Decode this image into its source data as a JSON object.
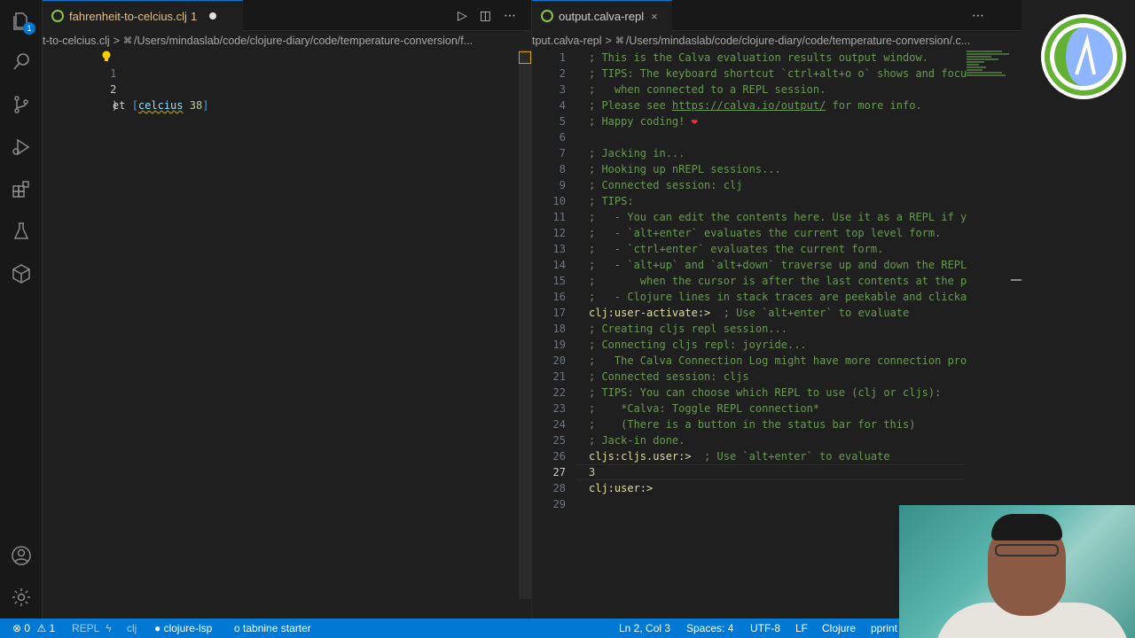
{
  "activity": {
    "badge_count": "1"
  },
  "left_editor": {
    "tab_label": "fahrenheit-to-celcius.clj",
    "tab_problems": "1",
    "breadcrumb_file": "t-to-celcius.clj",
    "breadcrumb_sep": ">",
    "breadcrumb_path": "/Users/mindaslab/code/clojure-diary/code/temperature-conversion/f...",
    "lines": [
      {
        "num": "1",
        "prefix": "et ",
        "bracket_open": "[",
        "sym": "celcius",
        "num_val": "38",
        "bracket_close": "]"
      },
      {
        "num": "2",
        "text": ")"
      }
    ]
  },
  "right_editor": {
    "tab_label": "output.calva-repl",
    "tab_close": "×",
    "breadcrumb_file": "tput.calva-repl",
    "breadcrumb_sep": ">",
    "breadcrumb_path": "/Users/mindaslab/code/clojure-diary/code/temperature-conversion/.c...",
    "line_4": {
      "before": "; Please see ",
      "link": "https://calva.io/output/",
      "after": " for more info."
    },
    "line_5": {
      "text": "; Happy coding! ",
      "heart": "❤"
    },
    "line_17": {
      "prompt": "clj:user-activate:>",
      "comment": "  ; Use `alt+enter` to evaluate"
    },
    "line_26": {
      "prompt": "cljs:cljs.user:>",
      "comment": "  ; Use `alt+enter` to evaluate"
    },
    "line_28": {
      "prompt": "clj:user:>"
    },
    "lines": [
      {
        "num": "1",
        "text": "; This is the Calva evaluation results output window."
      },
      {
        "num": "2",
        "text": "; TIPS: The keyboard shortcut `ctrl+alt+o o` shows and focus"
      },
      {
        "num": "3",
        "text": ";   when connected to a REPL session."
      },
      {
        "num": "6",
        "text": ""
      },
      {
        "num": "7",
        "text": "; Jacking in..."
      },
      {
        "num": "8",
        "text": "; Hooking up nREPL sessions..."
      },
      {
        "num": "9",
        "text": "; Connected session: clj"
      },
      {
        "num": "10",
        "text": "; TIPS:"
      },
      {
        "num": "11",
        "text": ";   - You can edit the contents here. Use it as a REPL if yo"
      },
      {
        "num": "12",
        "text": ";   - `alt+enter` evaluates the current top level form."
      },
      {
        "num": "13",
        "text": ";   - `ctrl+enter` evaluates the current form."
      },
      {
        "num": "14",
        "text": ";   - `alt+up` and `alt+down` traverse up and down the REPL"
      },
      {
        "num": "15",
        "text": ";       when the cursor is after the last contents at the pro"
      },
      {
        "num": "16",
        "text": ";   - Clojure lines in stack traces are peekable and clickab"
      },
      {
        "num": "18",
        "text": "; Creating cljs repl session..."
      },
      {
        "num": "19",
        "text": "; Connecting cljs repl: joyride..."
      },
      {
        "num": "20",
        "text": ";   The Calva Connection Log might have more connection prog"
      },
      {
        "num": "21",
        "text": "; Connected session: cljs"
      },
      {
        "num": "22",
        "text": "; TIPS: You can choose which REPL to use (clj or cljs):"
      },
      {
        "num": "23",
        "text": ";    *Calva: Toggle REPL connection*"
      },
      {
        "num": "24",
        "text": ";    (There is a button in the status bar for this)"
      },
      {
        "num": "25",
        "text": "; Jack-in done."
      },
      {
        "num": "27",
        "text": "3"
      },
      {
        "num": "29",
        "text": ""
      }
    ],
    "line_nums": {
      "n4": "4",
      "n5": "5",
      "n17": "17",
      "n26": "26",
      "n28": "28"
    }
  },
  "statusbar": {
    "errors": "0",
    "warnings": "1",
    "repl": "REPL",
    "clj": "clj",
    "lsp": "clojure-lsp",
    "tabnine": "tabnine starter",
    "position": "Ln 2, Col 3",
    "spaces": "Spaces: 4",
    "encoding": "UTF-8",
    "eol": "LF",
    "language": "Clojure",
    "pprint": "pprint"
  },
  "icons": [
    "explorer-icon",
    "search-icon",
    "source-control-icon",
    "run-debug-icon",
    "extensions-icon",
    "testing-icon",
    "package-icon",
    "account-icon",
    "settings-gear-icon"
  ]
}
